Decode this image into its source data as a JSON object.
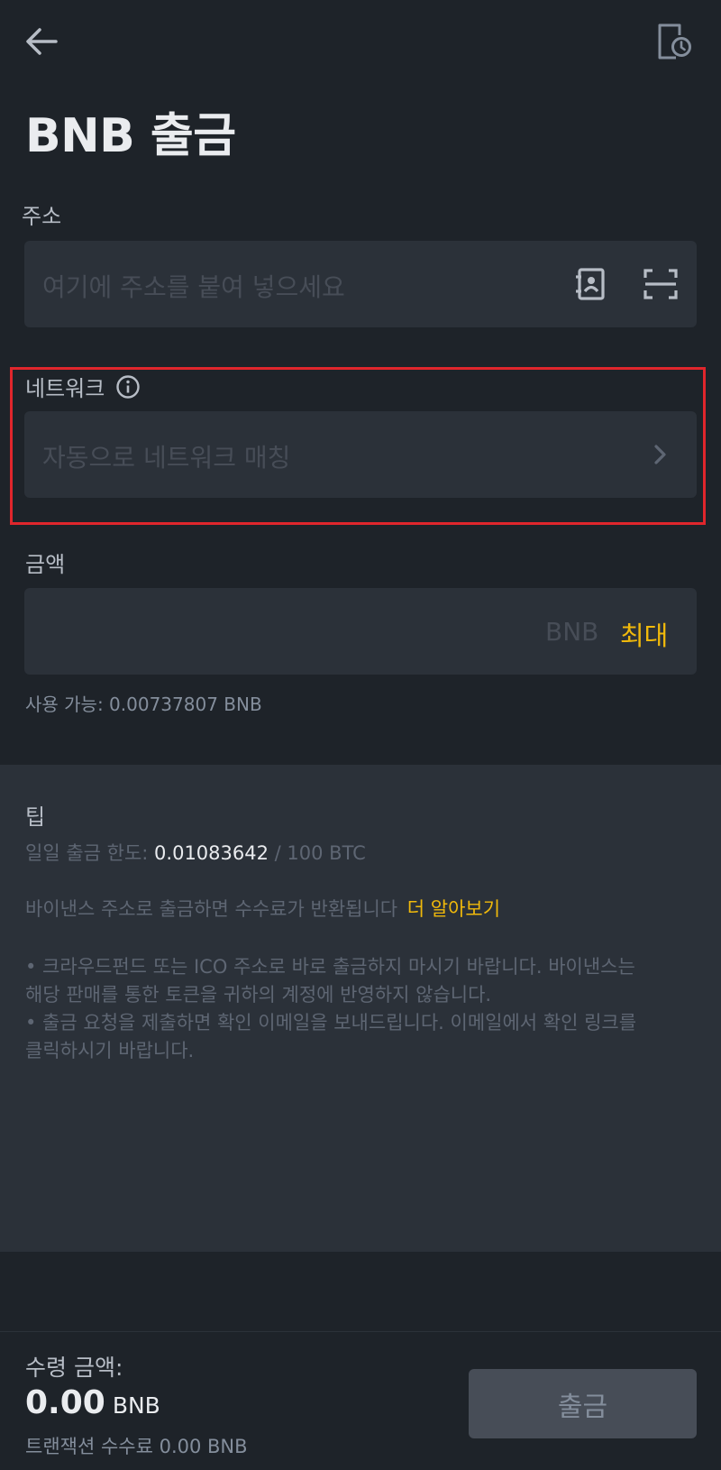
{
  "header": {
    "back_icon": "arrow-left-icon",
    "history_icon": "document-clock-icon",
    "title": "BNB 출금"
  },
  "address": {
    "label": "주소",
    "placeholder": "여기에 주소를 붙여 넣으세요",
    "address_book_icon": "address-book-icon",
    "scan_icon": "scan-icon"
  },
  "network": {
    "label": "네트워크",
    "info_icon": "info-icon",
    "placeholder": "자동으로 네트워크 매칭",
    "chevron_icon": "chevron-right-icon"
  },
  "amount": {
    "label": "금액",
    "currency": "BNB",
    "max_label": "최대",
    "available": "사용 가능: 0.00737807 BNB"
  },
  "tips": {
    "title": "팁",
    "daily_limit_prefix": "일일 출금 한도:",
    "daily_limit_value": "0.01083642",
    "daily_limit_suffix": "/ 100 BTC",
    "refund_text": "바이낸스 주소로 출금하면 수수료가 반환됩니다",
    "learn_more": "더 알아보기",
    "bullet1_line1": "• 크라우드펀드 또는 ICO 주소로 바로 출금하지 마시기 바랍니다. 바이낸스는",
    "bullet1_line2": "해당 판매를 통한 토큰을 귀하의 계정에 반영하지 않습니다.",
    "bullet2_line1": "• 출금 요청을 제출하면 확인 이메일을 보내드립니다. 이메일에서 확인 링크를",
    "bullet2_line2": "클릭하시기 바랍니다."
  },
  "footer": {
    "receive_label": "수령 금액:",
    "receive_amount": "0.00",
    "receive_currency": "BNB",
    "fee_text": "트랜잭션 수수료 0.00 BNB",
    "withdraw_button": "출금"
  },
  "colors": {
    "background": "#1e2329",
    "field": "#2b3139",
    "accent": "#f0b90b",
    "highlight": "#e0262c"
  }
}
